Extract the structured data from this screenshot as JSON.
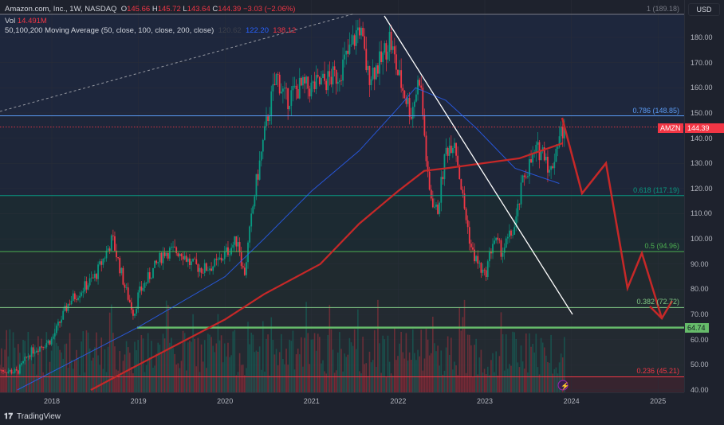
{
  "header": {
    "symbol": "Amazon.com, Inc., 1W, NASDAQ",
    "open_label": "O",
    "open": "145.66",
    "high_label": "H",
    "high": "145.72",
    "low_label": "L",
    "low": "143.64",
    "close_label": "C",
    "close": "144.39",
    "change": "−3.03 (−2.06%)"
  },
  "volume": {
    "label": "Vol",
    "value": "14.491M"
  },
  "ma": {
    "label": "50,100,200 Moving Average (50, close, 100, close, 200, close)",
    "ma50": "120.62",
    "ma100": "122.20",
    "ma200": "138.12"
  },
  "currency": "USD",
  "price_badge": {
    "symbol": "AMZN",
    "price": "144.39"
  },
  "level_badge": "64.74",
  "fib_levels": [
    {
      "label": "1 (189.18)",
      "price": 189.18,
      "color": "#787b86"
    },
    {
      "label": "0.786 (148.85)",
      "price": 148.85,
      "color": "#5b9cf6"
    },
    {
      "label": "0.618 (117.19)",
      "price": 117.19,
      "color": "#089981"
    },
    {
      "label": "0.5 (94.96)",
      "price": 94.96,
      "color": "#4caf50"
    },
    {
      "label": "0.382 (72.72)",
      "price": 72.72,
      "color": "#81c784"
    },
    {
      "label": "0.236 (45.21)",
      "price": 45.21,
      "color": "#f23645"
    }
  ],
  "footer": {
    "brand": "TradingView"
  },
  "colors": {
    "up": "#089981",
    "down": "#f23645",
    "ma100": "#2962ff",
    "ma200": "#c62828",
    "support": "#66bb6a"
  },
  "chart_data": {
    "type": "candlestick",
    "title": "Amazon.com, Inc., 1W, NASDAQ",
    "ylim": [
      40,
      189
    ],
    "y_ticks": [
      "180.00",
      "170.00",
      "160.00",
      "150.00",
      "140.00",
      "130.00",
      "120.00",
      "110.00",
      "100.00",
      "90.00",
      "80.00",
      "70.00",
      "60.00",
      "50.00",
      "40.00"
    ],
    "x_ticks": [
      "2018",
      "2019",
      "2020",
      "2021",
      "2022",
      "2023",
      "2024",
      "2025"
    ],
    "price_path": [
      [
        2017.4,
        48
      ],
      [
        2017.6,
        47
      ],
      [
        2017.75,
        55
      ],
      [
        2018.0,
        60
      ],
      [
        2018.2,
        75
      ],
      [
        2018.5,
        85
      ],
      [
        2018.7,
        100
      ],
      [
        2018.85,
        80
      ],
      [
        2018.95,
        70
      ],
      [
        2019.0,
        78
      ],
      [
        2019.3,
        95
      ],
      [
        2019.5,
        95
      ],
      [
        2019.6,
        90
      ],
      [
        2019.75,
        88
      ],
      [
        2019.9,
        90
      ],
      [
        2020.0,
        94
      ],
      [
        2020.15,
        100
      ],
      [
        2020.22,
        85
      ],
      [
        2020.35,
        120
      ],
      [
        2020.5,
        150
      ],
      [
        2020.6,
        165
      ],
      [
        2020.7,
        155
      ],
      [
        2020.85,
        160
      ],
      [
        2021.0,
        160
      ],
      [
        2021.3,
        165
      ],
      [
        2021.45,
        175
      ],
      [
        2021.55,
        185
      ],
      [
        2021.65,
        165
      ],
      [
        2021.8,
        170
      ],
      [
        2021.9,
        180
      ],
      [
        2022.0,
        165
      ],
      [
        2022.15,
        150
      ],
      [
        2022.25,
        165
      ],
      [
        2022.35,
        120
      ],
      [
        2022.45,
        110
      ],
      [
        2022.55,
        135
      ],
      [
        2022.65,
        140
      ],
      [
        2022.75,
        115
      ],
      [
        2022.85,
        95
      ],
      [
        2023.0,
        85
      ],
      [
        2023.1,
        100
      ],
      [
        2023.2,
        95
      ],
      [
        2023.35,
        105
      ],
      [
        2023.45,
        125
      ],
      [
        2023.6,
        135
      ],
      [
        2023.7,
        135
      ],
      [
        2023.75,
        125
      ],
      [
        2023.85,
        140
      ],
      [
        2023.92,
        144.39
      ]
    ],
    "ma100": [
      [
        2017.6,
        40
      ],
      [
        2019.0,
        65
      ],
      [
        2020.0,
        85
      ],
      [
        2020.45,
        100
      ],
      [
        2021.0,
        119
      ],
      [
        2021.55,
        135
      ],
      [
        2022.0,
        152
      ],
      [
        2022.2,
        160
      ],
      [
        2022.55,
        155
      ],
      [
        2022.9,
        144
      ],
      [
        2023.35,
        128
      ],
      [
        2023.86,
        122
      ]
    ],
    "ma200": [
      [
        2018.45,
        40
      ],
      [
        2019.0,
        50
      ],
      [
        2020.0,
        68
      ],
      [
        2020.45,
        78
      ],
      [
        2021.1,
        90
      ],
      [
        2021.55,
        106
      ],
      [
        2022.0,
        119
      ],
      [
        2022.3,
        127
      ],
      [
        2022.55,
        128
      ],
      [
        2023.4,
        132
      ],
      [
        2023.9,
        138
      ]
    ]
  }
}
